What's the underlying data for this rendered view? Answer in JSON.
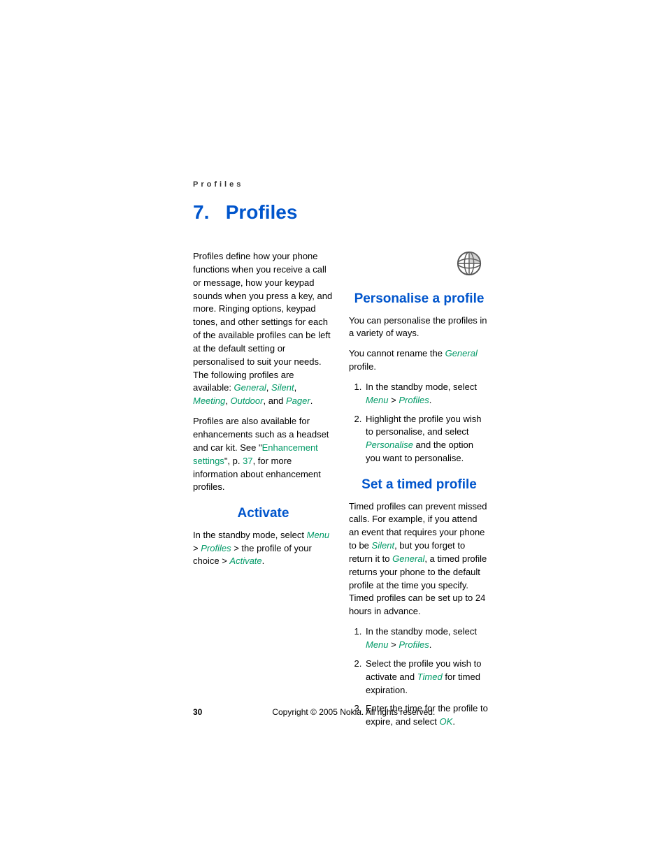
{
  "runningHead": "Profiles",
  "chapter": {
    "number": "7.",
    "title": "Profiles"
  },
  "colLeft": {
    "intro": {
      "pre": "Profiles define how your phone functions when you receive a call or message, how your keypad sounds when you press a key, and more. Ringing options, keypad tones, and other settings for each of the available profiles can be left at the default setting or personalised to suit your needs. The following profiles are available: ",
      "p1": "General",
      "c1": ", ",
      "p2": "Silent",
      "c2": ", ",
      "p3": "Meeting",
      "c3": ", ",
      "p4": "Outdoor",
      "c4": ", and ",
      "p5": "Pager",
      "post": "."
    },
    "enh": {
      "pre": "Profiles are also available for enhancements such as a headset and car kit. See \"",
      "xref": "Enhancement settings",
      "mid": "\", p. ",
      "pnum": "37",
      "post": ", for more information about enhancement profiles."
    },
    "activate": {
      "heading": "Activate",
      "pre": "In the standby mode, select ",
      "m": "Menu",
      "gt1": " > ",
      "pr": "Profiles",
      "gt2": " > the profile of your choice > ",
      "ac": "Activate",
      "post": "."
    }
  },
  "colRight": {
    "personalise": {
      "heading": "Personalise a profile",
      "p1": "You can personalise the profiles in a variety of ways.",
      "p2pre": "You cannot rename the ",
      "p2term": "General",
      "p2post": " profile.",
      "li1pre": "In the standby mode, select ",
      "li1m": "Menu",
      "li1gt": " > ",
      "li1pr": "Profiles",
      "li1post": ".",
      "li2pre": "Highlight the profile you wish to personalise, and select ",
      "li2term": "Personalise",
      "li2post": " and the option you want to personalise."
    },
    "timed": {
      "heading": "Set a timed profile",
      "p1pre": "Timed profiles can prevent missed calls. For example, if you attend an event that requires your phone to be ",
      "p1s": "Silent",
      "p1mid": ", but you forget to return it to ",
      "p1g": "General",
      "p1post": ", a timed profile returns your phone to the default profile at the time you specify. Timed profiles can be set up to 24 hours in advance.",
      "li1pre": "In the standby mode, select ",
      "li1m": "Menu",
      "li1gt": " > ",
      "li1pr": "Profiles",
      "li1post": ".",
      "li2pre": "Select the profile you wish to activate and ",
      "li2t": "Timed",
      "li2post": " for timed expiration.",
      "li3pre": "Enter the time for the profile to expire, and select ",
      "li3ok": "OK",
      "li3post": "."
    }
  },
  "footer": {
    "pageNum": "30",
    "copyright": "Copyright © 2005 Nokia. All rights reserved."
  }
}
